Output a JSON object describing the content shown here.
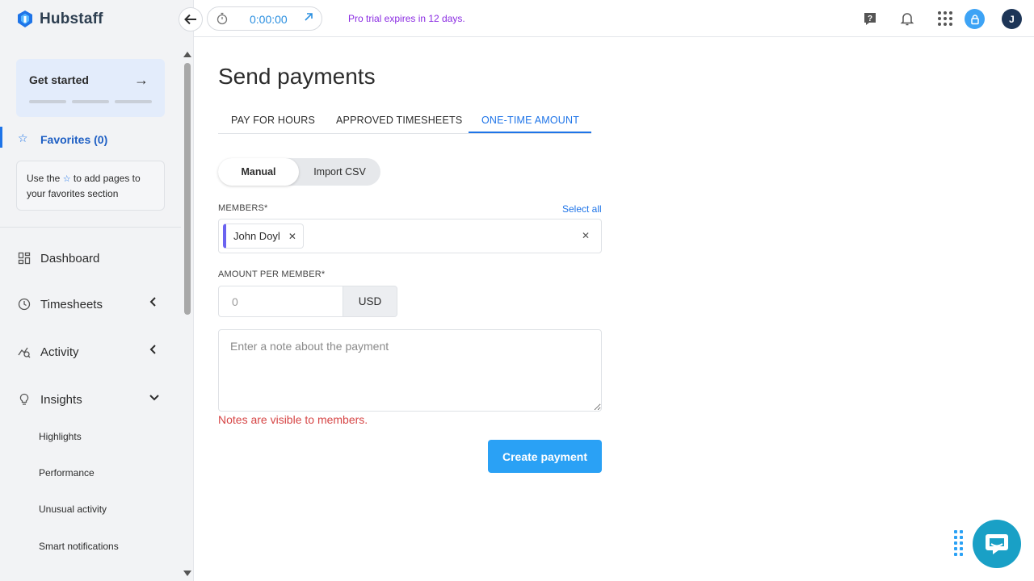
{
  "app": {
    "name": "Hubstaff"
  },
  "sidebar": {
    "get_started": "Get started",
    "favorites_label": "Favorites (0)",
    "favorites_hint_pre": "Use the",
    "favorites_hint_post": "to add pages to your favorites section",
    "nav": [
      {
        "label": "Dashboard"
      },
      {
        "label": "Timesheets"
      },
      {
        "label": "Activity"
      },
      {
        "label": "Insights"
      }
    ],
    "insights_sub": [
      "Highlights",
      "Performance",
      "Unusual activity",
      "Smart notifications"
    ]
  },
  "topbar": {
    "timer": "0:00:00",
    "trial_notice": "Pro trial expires in 12 days.",
    "user_initial": "J"
  },
  "page": {
    "title": "Send payments",
    "tabs": [
      "PAY FOR HOURS",
      "APPROVED TIMESHEETS",
      "ONE-TIME AMOUNT"
    ],
    "active_tab": "ONE-TIME AMOUNT",
    "mode_options": [
      "Manual",
      "Import CSV"
    ],
    "active_mode": "Manual",
    "members_label": "MEMBERS*",
    "select_all": "Select all",
    "selected_members": [
      "John Doyl"
    ],
    "amount_label": "AMOUNT PER MEMBER*",
    "amount_placeholder": "0",
    "currency": "USD",
    "note_placeholder": "Enter a note about the payment",
    "note_hint": "Notes are visible to members.",
    "create_button": "Create payment"
  },
  "colors": {
    "accent": "#1e74e8",
    "button": "#2aa1f5",
    "trial_text": "#8a2be2",
    "warning_text": "#d64545",
    "chat": "#19a0c6"
  }
}
